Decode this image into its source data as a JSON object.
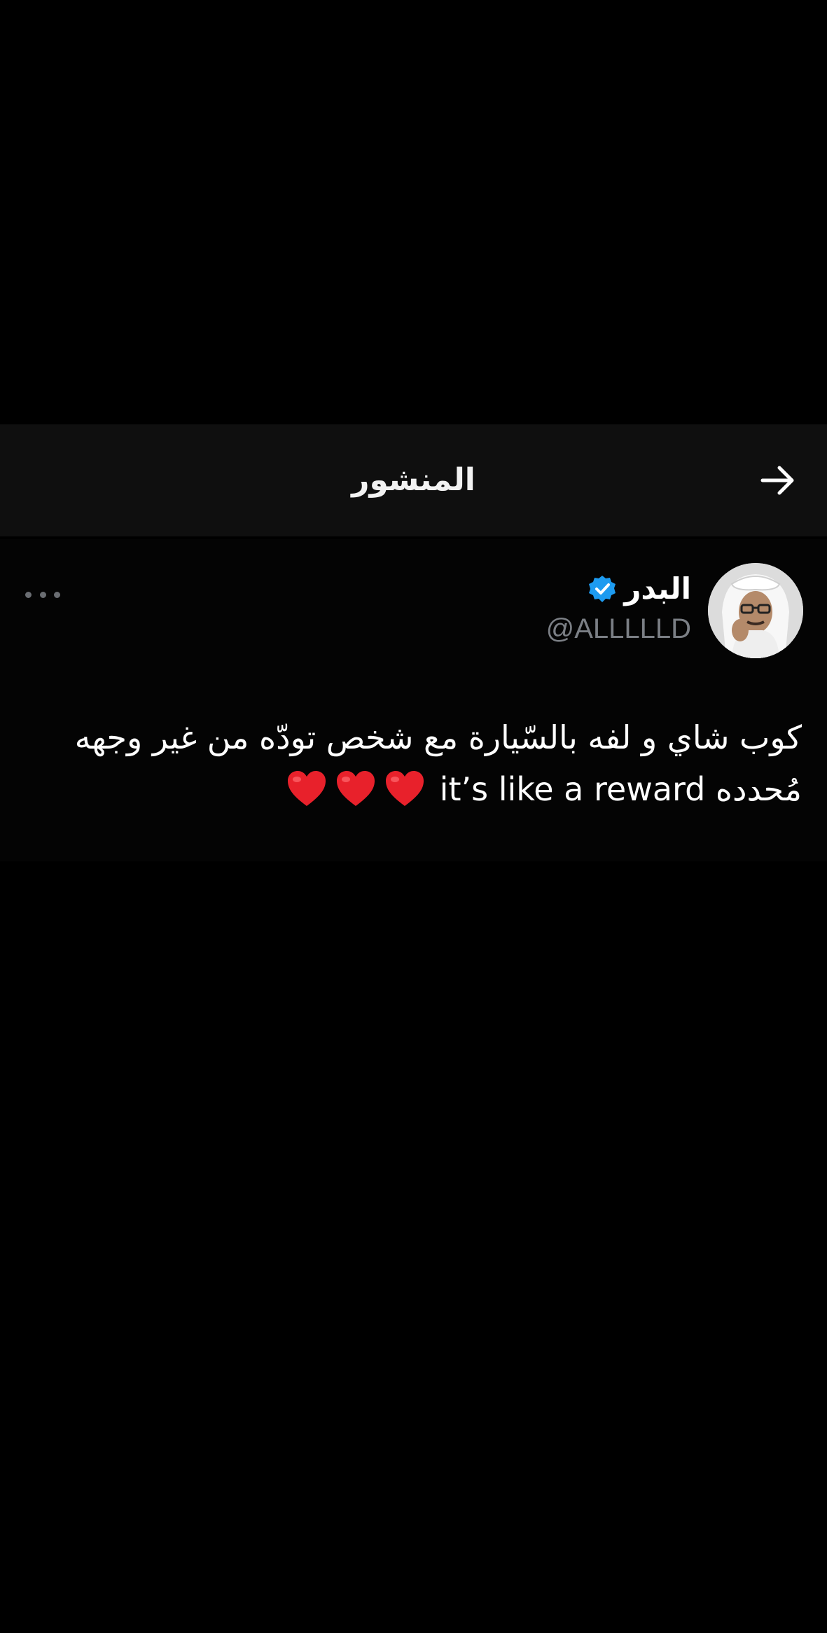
{
  "header": {
    "title": "المنشور",
    "back_icon": "arrow-right-icon"
  },
  "post": {
    "display_name": "البدر",
    "verified": true,
    "verified_color": "#1d9bf0",
    "handle": "@ALLLLLD",
    "more_icon": "more-horizontal-icon",
    "text_line_1": "كوب شاي و لفه بالسّيارة مع شخص تودّه من غير وجهه",
    "text_line_2": "مُحدده it’s like a reward",
    "emoji_count": 3,
    "emoji_icon": "red-heart-icon",
    "heart_color": "#e8212b"
  },
  "colors": {
    "background": "#000000",
    "header_background": "#0f0f0f",
    "text": "#ffffff",
    "muted": "#7b7f85"
  }
}
